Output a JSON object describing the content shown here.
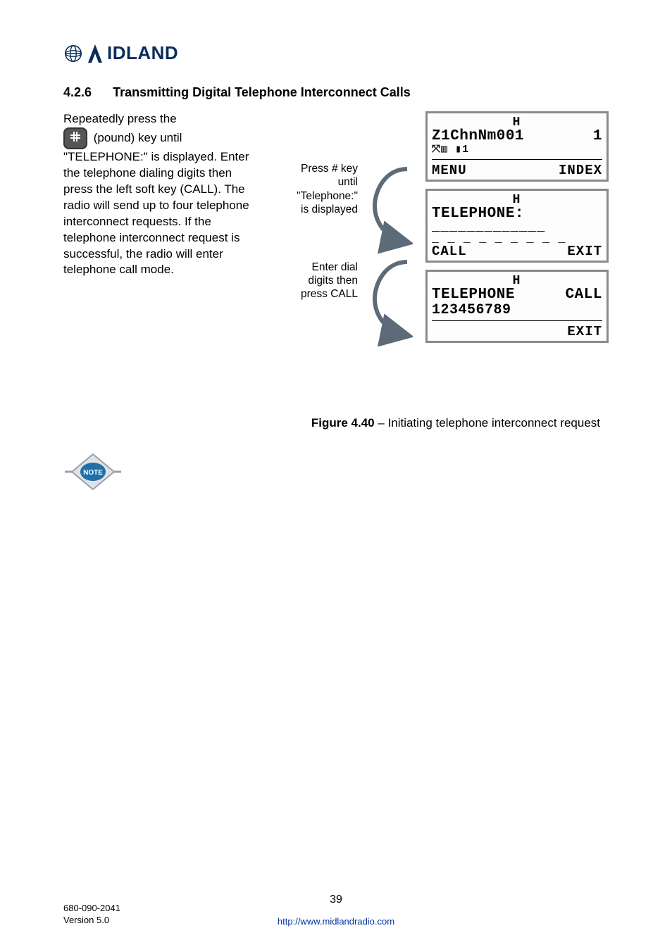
{
  "logo": {
    "text": "IDLAND"
  },
  "heading": {
    "num": "4.2.6",
    "title": "Transmitting Digital Telephone Interconnect Calls"
  },
  "body": {
    "pre": "Repeatedly press the",
    "post": " (pound) key until \"TELEPHONE:\" is displayed. Enter the telephone dialing digits then press the left soft key (CALL). The radio will send up to four telephone interconnect requests. If the telephone interconnect request is successful, the radio will enter telephone call mode."
  },
  "mid": {
    "block1": "Press # key until \"Telephone:\" is displayed",
    "block1_l1": "Press # key",
    "block1_l2": "until",
    "block1_l3": "\"Telephone:\"",
    "block1_l4": "is displayed",
    "block2_l1": "Enter dial",
    "block2_l2": "digits then",
    "block2_l3": "press CALL"
  },
  "lcd1": {
    "h": "H",
    "title": "Z1ChnNm001",
    "idx": "1",
    "icons": "⤧▥  ▮1",
    "left": "MENU",
    "right": "INDEX"
  },
  "lcd2": {
    "h": "H",
    "title": "TELEPHONE:",
    "under": "_____________",
    "dash": "_ _ _ _ _ _ _ _ _",
    "left": "CALL",
    "right": "EXIT"
  },
  "lcd3": {
    "h": "H",
    "l1a": "TELEPHONE",
    "l1b": "CALL",
    "l2": "123456789",
    "right": "EXIT"
  },
  "figure": {
    "bold": "Figure 4.40",
    "rest": " – Initiating telephone interconnect request"
  },
  "footer": {
    "doc": "680-090-2041",
    "ver": "Version 5.0",
    "page": "39",
    "url": "http://www.midlandradio.com"
  }
}
